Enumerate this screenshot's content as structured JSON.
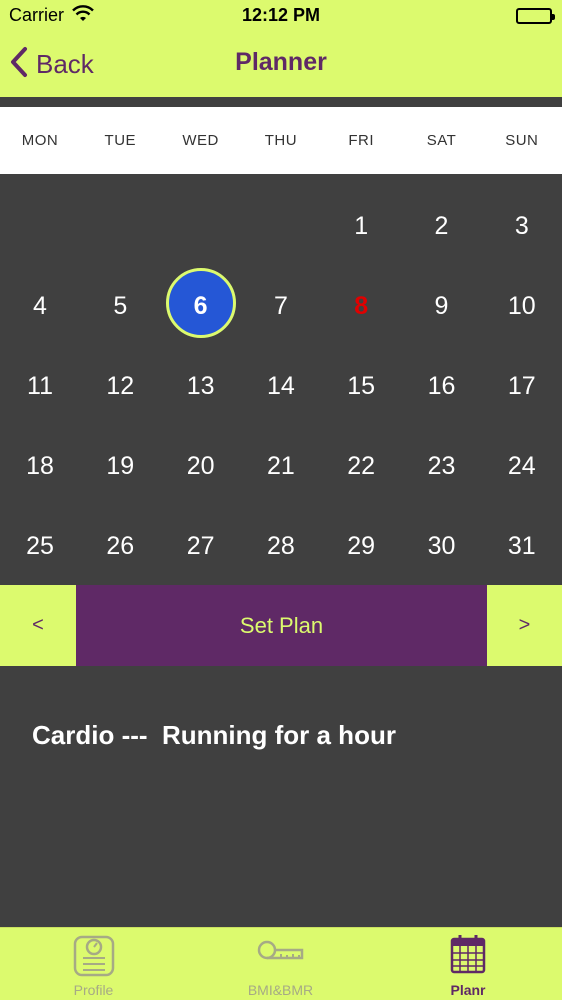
{
  "status_bar": {
    "carrier": "Carrier",
    "time": "12:12 PM",
    "wifi_icon": "wifi-icon",
    "battery_icon": "battery-icon",
    "battery_level": 1.0
  },
  "nav": {
    "back_label": "Back",
    "back_icon": "chevron-left-icon",
    "title": "Planner"
  },
  "weekdays": [
    "MON",
    "TUE",
    "WED",
    "THU",
    "FRI",
    "SAT",
    "SUN"
  ],
  "calendar": {
    "first_weekday_index": 4,
    "days_in_month": 31,
    "selected_day": 6,
    "highlighted_day": 8,
    "selected_color": "#2557d6",
    "highlight_color": "#e00000"
  },
  "plan_bar": {
    "prev_label": "<",
    "next_label": ">",
    "set_plan_label": "Set Plan"
  },
  "plan_content": {
    "text": "Cardio ---  Running for a hour"
  },
  "tabs": [
    {
      "label": "Profile",
      "icon": "scale-icon",
      "active": false
    },
    {
      "label": "BMI&BMR",
      "icon": "tape-measure-icon",
      "active": false
    },
    {
      "label": "Planr",
      "icon": "calendar-icon",
      "active": true
    }
  ],
  "colors": {
    "accent_lime": "#dcfa6e",
    "accent_purple": "#5f2966",
    "background_dark": "#404040"
  }
}
